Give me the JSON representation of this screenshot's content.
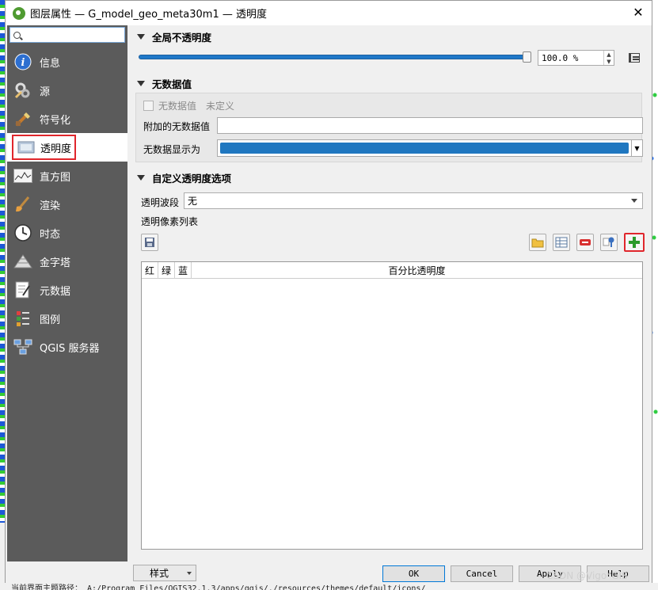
{
  "window": {
    "title": "图层属性 — G_model_geo_meta30m1 — 透明度"
  },
  "search": {
    "placeholder": ""
  },
  "sidebar": {
    "items": [
      {
        "label": "信息",
        "icon": "info-icon"
      },
      {
        "label": "源",
        "icon": "source-icon"
      },
      {
        "label": "符号化",
        "icon": "symbology-icon"
      },
      {
        "label": "透明度",
        "icon": "transparency-icon",
        "active": true
      },
      {
        "label": "直方图",
        "icon": "histogram-icon"
      },
      {
        "label": "渲染",
        "icon": "rendering-icon"
      },
      {
        "label": "时态",
        "icon": "temporal-icon"
      },
      {
        "label": "金字塔",
        "icon": "pyramids-icon"
      },
      {
        "label": "元数据",
        "icon": "metadata-icon"
      },
      {
        "label": "图例",
        "icon": "legend-icon"
      },
      {
        "label": "QGIS 服务器",
        "icon": "qgis-server-icon"
      }
    ]
  },
  "global_opacity": {
    "heading": "全局不透明度",
    "value": "100.0 %",
    "level": 1.0
  },
  "no_data": {
    "heading": "无数据值",
    "checkbox_label": "无数据值",
    "undefined_text": "未定义",
    "additional_label": "附加的无数据值",
    "additional_value": "",
    "display_label": "无数据显示为",
    "display_color": "#1f77c0"
  },
  "custom_transparency": {
    "heading": "自定义透明度选项",
    "band_label": "透明波段",
    "band_value": "无",
    "pixel_list_label": "透明像素列表",
    "columns": [
      "红",
      "绿",
      "蓝",
      "百分比透明度"
    ]
  },
  "footer": {
    "style_label": "样式",
    "ok_label": "OK",
    "cancel_label": "Cancel",
    "apply_label": "Apply",
    "help_label": "Help"
  },
  "status_text": "当前界面主题路径： A:/Program Files/QGIS32.1.3/apps/qgis/./resources/themes/default/icons/",
  "watermark": "CSDN @Vigo*GIS",
  "colors": {
    "accent": "#1f78c8",
    "highlight_border": "#e0262c",
    "sidebar_bg": "#5b5b5b"
  }
}
